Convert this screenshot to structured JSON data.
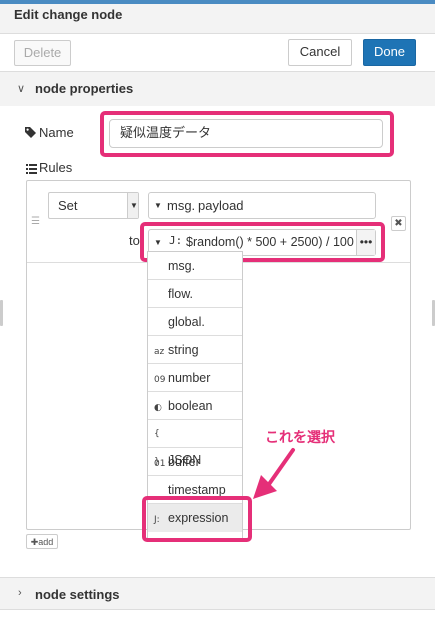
{
  "dialog": {
    "title": "Edit change node"
  },
  "buttons": {
    "delete_label": "Delete",
    "cancel_label": "Cancel",
    "done_label": "Done"
  },
  "properties_section": {
    "label": "node properties"
  },
  "name_field": {
    "label": "Name",
    "value": "疑似温度データ"
  },
  "rules": {
    "label": "Rules",
    "action": "Set",
    "target_prefix": "msg.",
    "target_value": "payload",
    "to_label": "to",
    "expression_value": "$random() * 500 + 2500) / 100",
    "add_label": "add"
  },
  "type_menu": {
    "items": [
      {
        "icon": "",
        "label": "msg."
      },
      {
        "icon": "",
        "label": "flow."
      },
      {
        "icon": "",
        "label": "global."
      },
      {
        "icon": "az",
        "label": "string"
      },
      {
        "icon": "09",
        "label": "number"
      },
      {
        "icon": "◐",
        "label": "boolean"
      },
      {
        "icon": "{ }",
        "label": "JSON"
      },
      {
        "icon": "01",
        "label": "buffer"
      },
      {
        "icon": "",
        "label": "timestamp"
      },
      {
        "icon": "J:",
        "label": "expression"
      }
    ]
  },
  "annotation": {
    "text": "これを選択"
  },
  "settings_section": {
    "label": "node settings"
  },
  "colors": {
    "accent": "#1e74b5",
    "highlight": "#e52f78"
  }
}
